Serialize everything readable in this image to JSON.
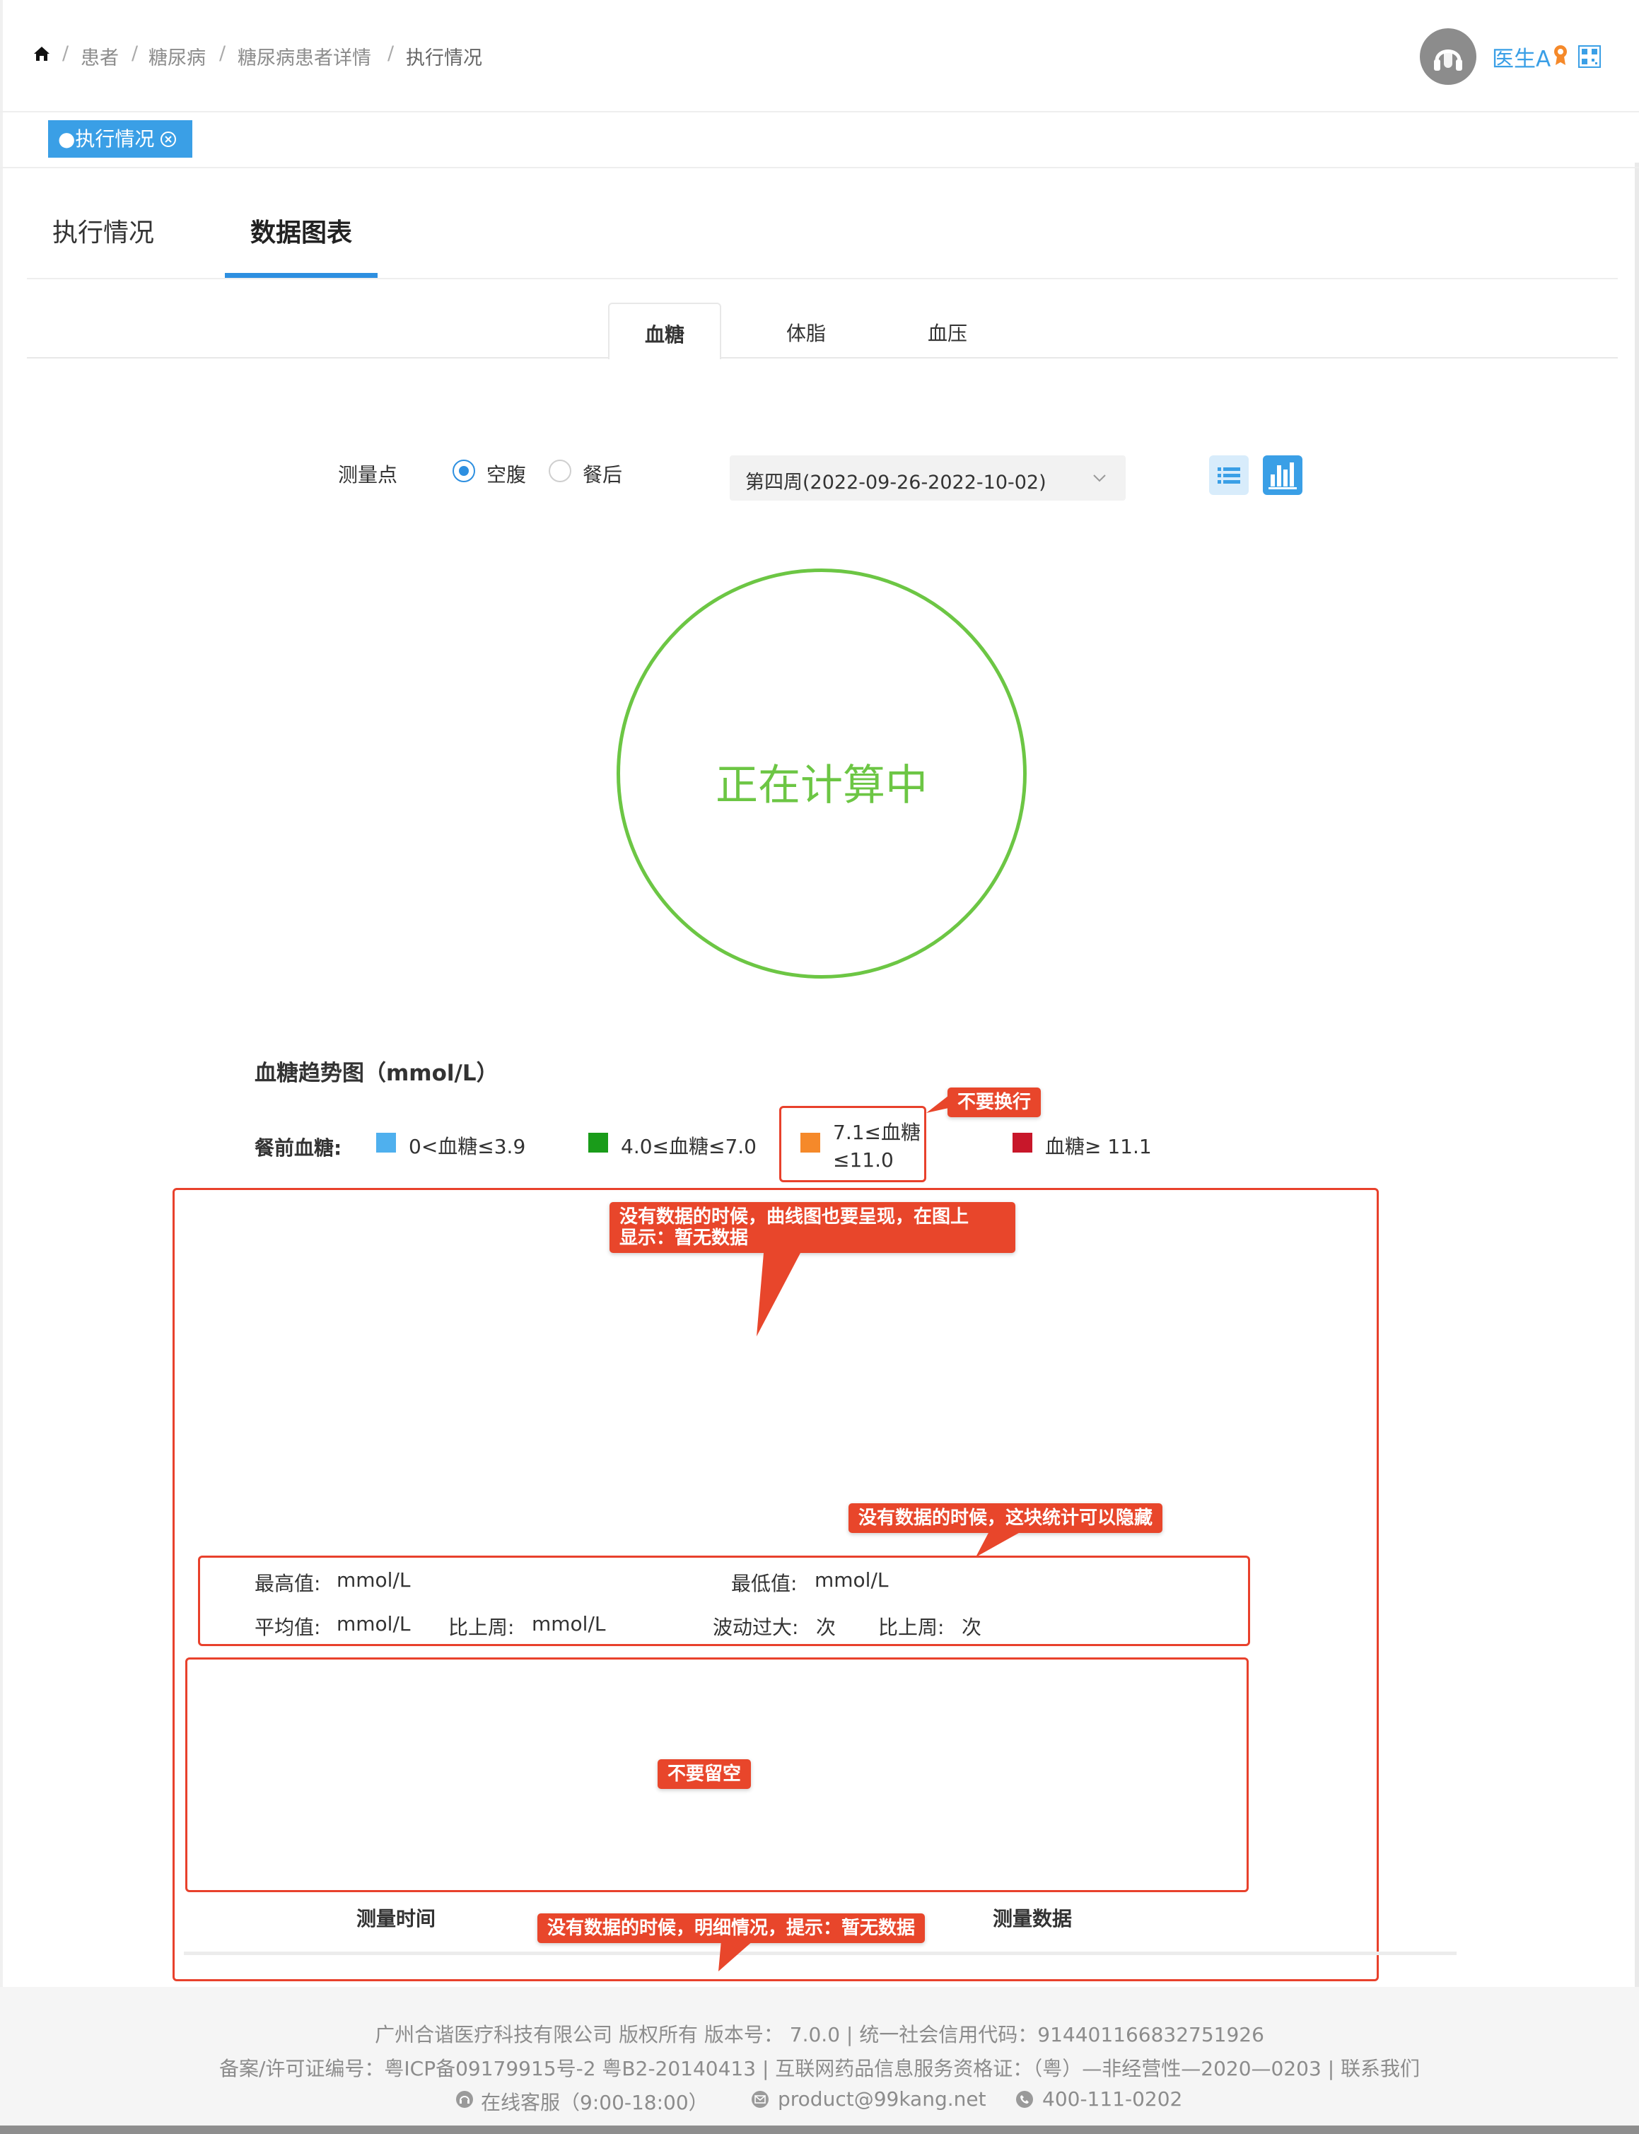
{
  "breadcrumb": {
    "items": [
      "患者",
      "糖尿病",
      "糖尿病患者详情",
      "执行情况"
    ],
    "separator": "/"
  },
  "user": {
    "name": "医生A"
  },
  "tag": {
    "label": "●执行情况"
  },
  "main_tabs": [
    {
      "label": "执行情况"
    },
    {
      "label": "数据图表"
    }
  ],
  "sub_tabs": [
    {
      "label": "血糖"
    },
    {
      "label": "体脂"
    },
    {
      "label": "血压"
    }
  ],
  "filters": {
    "measure_label": "测量点",
    "options": [
      "空腹",
      "餐后"
    ],
    "selected": "空腹",
    "week_select": "第四周(2022-09-26-2022-10-02)"
  },
  "status_circle": {
    "text": "正在计算中",
    "color": "#6cc644"
  },
  "trend": {
    "title": "血糖趋势图（mmol/L）",
    "legend_title": "餐前血糖:",
    "legend": [
      {
        "label": "0<血糖≤3.9",
        "color": "#4fb0ee"
      },
      {
        "label": "4.0≤血糖≤7.0",
        "color": "#1a9c1a"
      },
      {
        "label_line1": "7.1≤血糖",
        "label_line2": "≤11.0",
        "color": "#f5892a"
      },
      {
        "label": "血糖≥ 11.1",
        "color": "#c8172a"
      }
    ]
  },
  "stats": {
    "max_label": "最高值:",
    "max_unit": "mmol/L",
    "min_label": "最低值:",
    "min_unit": "mmol/L",
    "avg_label": "平均值:",
    "avg_unit": "mmol/L",
    "vs_last_label": "比上周:",
    "vs_last_unit": "mmol/L",
    "fluct_label": "波动过大:",
    "fluct_unit": "次",
    "vs_last2_label": "比上周:",
    "vs_last2_unit": "次"
  },
  "table": {
    "col_time": "测量时间",
    "col_data": "测量数据"
  },
  "annotations": {
    "no_wrap": "不要换行",
    "chart_empty_line1": "没有数据的时候，曲线图也要呈现，在图上",
    "chart_empty_line2": "显示：暂无数据",
    "hide_stats": "没有数据的时候，这块统计可以隐藏",
    "no_blank": "不要留空",
    "detail_empty": "没有数据的时候，明细情况，提示：暂无数据"
  },
  "footer": {
    "line1": "广州合谐医疗科技有限公司 版权所有 版本号：  7.0.0 | 统一社会信用代码：914401166832751926",
    "line2": "备案/许可证编号：粤ICP备09179915号-2 粤B2-20140413 | 互联网药品信息服务资格证：（粤）—非经营性—2020—0203 | 联系我们",
    "service": "在线客服（9:00-18:00）",
    "email": "product@99kang.net",
    "phone": "400-111-0202"
  }
}
